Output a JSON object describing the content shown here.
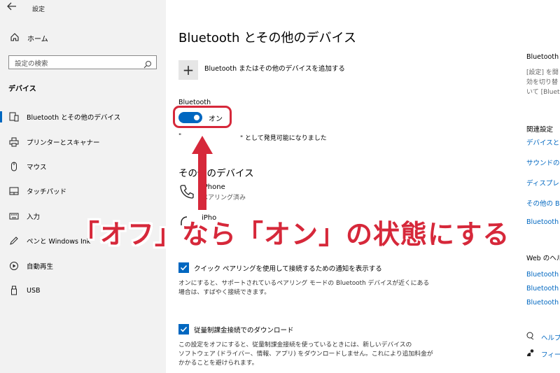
{
  "window": {
    "title": "設定",
    "back_icon": "back-arrow-icon"
  },
  "sidebar": {
    "home_label": "ホーム",
    "search": {
      "placeholder": "設定の検索"
    },
    "section_title": "デバイス",
    "items": [
      {
        "label": "Bluetooth とその他のデバイス",
        "icon": "bluetooth-device-icon",
        "selected": true
      },
      {
        "label": "プリンターとスキャナー",
        "icon": "printer-icon"
      },
      {
        "label": "マウス",
        "icon": "mouse-icon"
      },
      {
        "label": "タッチパッド",
        "icon": "touchpad-icon"
      },
      {
        "label": "入力",
        "icon": "keyboard-icon"
      },
      {
        "label": "ペンと Windows Ink",
        "icon": "pen-icon"
      },
      {
        "label": "自動再生",
        "icon": "autoplay-icon"
      },
      {
        "label": "USB",
        "icon": "usb-icon"
      }
    ]
  },
  "main": {
    "title": "Bluetooth とその他のデバイス",
    "add_device_label": "Bluetooth またはその他のデバイスを追加する",
    "bluetooth_label": "Bluetooth",
    "toggle": {
      "state_label": "オン",
      "on": true
    },
    "discoverable_open_quote": "\"",
    "discoverable_text": "\" として発見可能になりました",
    "other_devices_title": "その他のデバイス",
    "devices": [
      {
        "name": "iPhone",
        "status": "ペアリング済み",
        "icon": "phone-icon"
      },
      {
        "name": "iPho",
        "status": "",
        "icon": "headphones-icon"
      }
    ],
    "quick_pair": {
      "checked": true,
      "label": "クイック ペアリングを使用して接続するための通知を表示する",
      "desc_line1": "オンにすると、サポートされているペアリング モードの Bluetooth デバイスが近くにある",
      "desc_line2": "場合は、すばやく接続できます。"
    },
    "metered": {
      "checked": true,
      "label": "従量制課金接続でのダウンロード",
      "desc_line1": "この設定をオフにすると、従量制課金接続を使っているときには、新しいデバイスの",
      "desc_line2": "ソフトウェア (ドライバー、情報、アプリ) をダウンロードしません。これにより追加料金が",
      "desc_line3": "かかることを避けられます。"
    }
  },
  "right_rail": {
    "bt_heading": "Bluetooth",
    "bt_desc1": "[設定] を開",
    "bt_desc2": "効を切り替",
    "bt_desc3": "いて [Blueto",
    "related_title": "関連設定",
    "related_links": [
      "デバイスと",
      "サウンドの",
      "ディスプレイ",
      "その他の B",
      "Bluetooth"
    ],
    "web_title": "Web のヘル",
    "web_links": [
      "Bluetooth",
      "Bluetooth",
      "Bluetooth"
    ],
    "help_label": "ヘルプ",
    "feedback_label": "フィード"
  },
  "annotation": {
    "caption": "「オフ」なら「オン」の状態にする",
    "color": "#d6283a"
  },
  "colors": {
    "accent": "#0067c0",
    "annotation": "#d6283a",
    "sidebar_bg": "#f2f2f2"
  }
}
